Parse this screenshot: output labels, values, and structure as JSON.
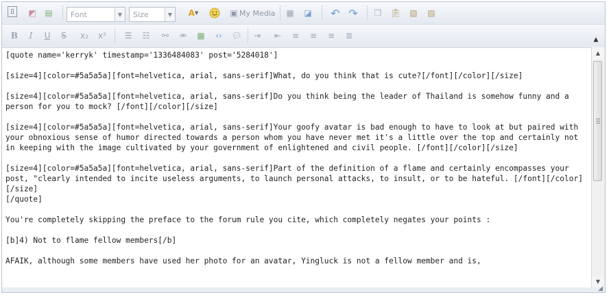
{
  "toolbar_row1": {
    "font_select": "Font",
    "size_select": "Size",
    "text_color_glyph": "A",
    "media_label": "My Media",
    "icons": [
      "source-icon",
      "remove-format-icon",
      "paste-text-icon",
      "text-color-icon",
      "smiley-icon",
      "media-icon",
      "table-icon",
      "special-char-icon",
      "undo-icon",
      "redo-icon",
      "copy-icon",
      "paste-icon",
      "paste-word-icon",
      "paste-plain-icon"
    ]
  },
  "toolbar_row2": {
    "buttons": [
      {
        "name": "bold-icon",
        "glyph": "B"
      },
      {
        "name": "italic-icon",
        "glyph": "I"
      },
      {
        "name": "underline-icon",
        "glyph": "U"
      },
      {
        "name": "strikethrough-icon",
        "glyph": "S"
      },
      {
        "name": "subscript-icon",
        "glyph": "x₂"
      },
      {
        "name": "superscript-icon",
        "glyph": "x²"
      }
    ],
    "collapse_glyph": "▲"
  },
  "editor": {
    "line_quote_open": "[quote name='kerryk' timestamp='1336484083' post='5284018']",
    "p1": "[size=4][color=#5a5a5a][font=helvetica, arial, sans-serif]What, do you think that is cute?[/font][/color][/size]",
    "p2": "[size=4][color=#5a5a5a][font=helvetica, arial, sans-serif]Do you think being the leader of Thailand is somehow funny and a person for you to mock? [/font][/color][/size]",
    "p3": "[size=4][color=#5a5a5a][font=helvetica, arial, sans-serif]Your goofy avatar is bad enough to have to look at but paired with your obnoxious sense of humor directed towards a person whom you have never met it's a little over the top and certainly not in keeping with the image cultivated by your government of enlightened and civil people. [/font][/color][/size]",
    "p4": "[size=4][color=#5a5a5a][font=helvetica, arial, sans-serif]Part of the definition of a flame and certainly encompasses your post, \"clearly intended to incite useless arguments, to launch personal attacks, to insult, or to be hateful. [/font][/color][/size]",
    "line_quote_close": "[/quote]",
    "p5": "You're completely skipping the preface to the forum rule you cite, which completely negates your points :",
    "p6": "[b]4) Not to flame fellow members[/b]",
    "p7": "AFAIK, although some members have used her photo for an avatar, Yingluck is not a fellow member and is,"
  }
}
